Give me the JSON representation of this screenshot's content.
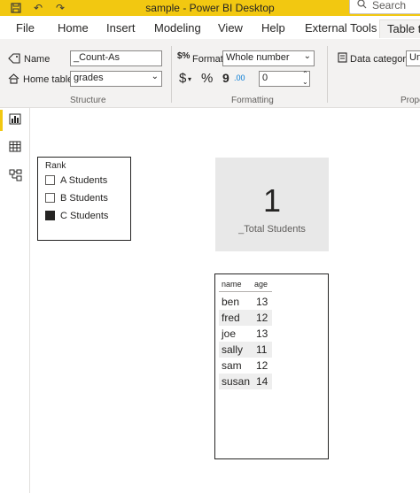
{
  "window": {
    "title": "sample - Power BI Desktop"
  },
  "titlebar": {
    "search_label": "Search"
  },
  "menu": {
    "tabs": [
      "File",
      "Home",
      "Insert",
      "Modeling",
      "View",
      "Help",
      "External Tools",
      "Table tools"
    ]
  },
  "ribbon": {
    "structure": {
      "name_label": "Name",
      "name_value": "_Count-As",
      "home_table_label": "Home table",
      "home_table_value": "grades",
      "caption": "Structure"
    },
    "formatting": {
      "format_label": "Format",
      "format_value": "Whole number",
      "currency_symbol": "$",
      "percent_symbol": "%",
      "comma_symbol": "9",
      "decimal_symbol": ".00",
      "decimal_places": "0",
      "caption": "Formatting"
    },
    "properties": {
      "data_category_label": "Data category",
      "data_category_value": "Un",
      "caption": "Prope"
    }
  },
  "slicer": {
    "title": "Rank",
    "options": [
      {
        "label": "A Students",
        "checked": false
      },
      {
        "label": "B Students",
        "checked": false
      },
      {
        "label": "C Students",
        "checked": true
      }
    ]
  },
  "card": {
    "value": "1",
    "label": "_Total Students"
  },
  "table": {
    "columns": [
      "name",
      "age"
    ],
    "rows": [
      [
        "ben",
        "13"
      ],
      [
        "fred",
        "12"
      ],
      [
        "joe",
        "13"
      ],
      [
        "sally",
        "11"
      ],
      [
        "sam",
        "12"
      ],
      [
        "susan",
        "14"
      ]
    ]
  },
  "colors": {
    "accent": "#f2c811",
    "card_bg": "#e8e8e8",
    "ribbon_bg": "#f3f2f1"
  }
}
